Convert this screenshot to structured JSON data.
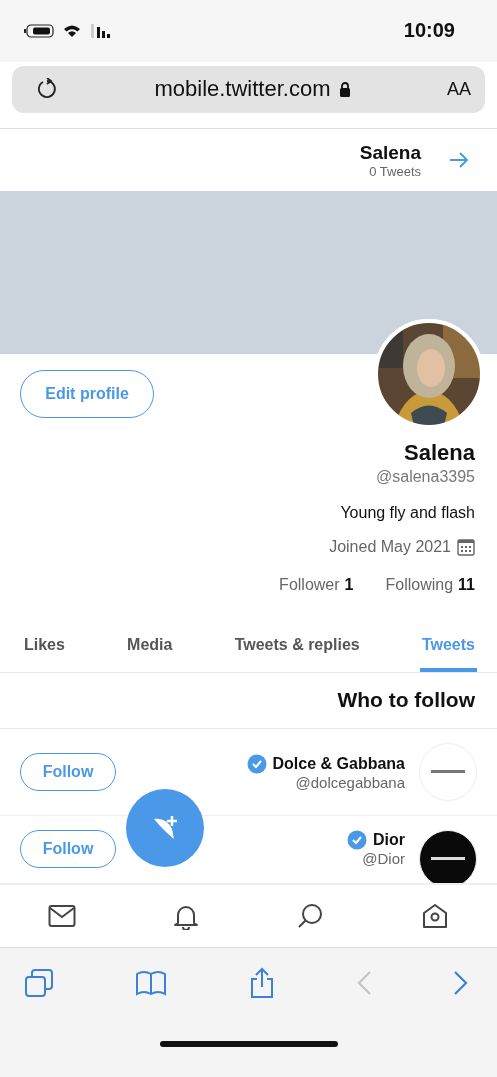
{
  "status_bar": {
    "time": "10:09"
  },
  "address_bar": {
    "text_size": "AA",
    "url": "mobile.twitter.com"
  },
  "header": {
    "name": "Salena",
    "tweet_count": "0 Tweets"
  },
  "profile": {
    "edit_button": "Edit profile",
    "name": "Salena",
    "handle": "@salena3395",
    "bio": "Young fly and flash",
    "joined": "Joined May 2021",
    "following_count": "11",
    "following_label": "Following",
    "followers_count": "1",
    "followers_label": "Follower"
  },
  "tabs": [
    {
      "label": "Likes",
      "selected": false
    },
    {
      "label": "Media",
      "selected": false
    },
    {
      "label": "Tweets & replies",
      "selected": false
    },
    {
      "label": "Tweets",
      "selected": true
    }
  ],
  "who_to_follow": {
    "title": "Who to follow",
    "accounts": [
      {
        "name": "Dolce & Gabbana",
        "handle": "@dolcegabbana",
        "verified": true,
        "button": "Follow"
      },
      {
        "name": "Dior",
        "handle": "@Dior",
        "verified": true,
        "button": "Follow"
      }
    ]
  }
}
